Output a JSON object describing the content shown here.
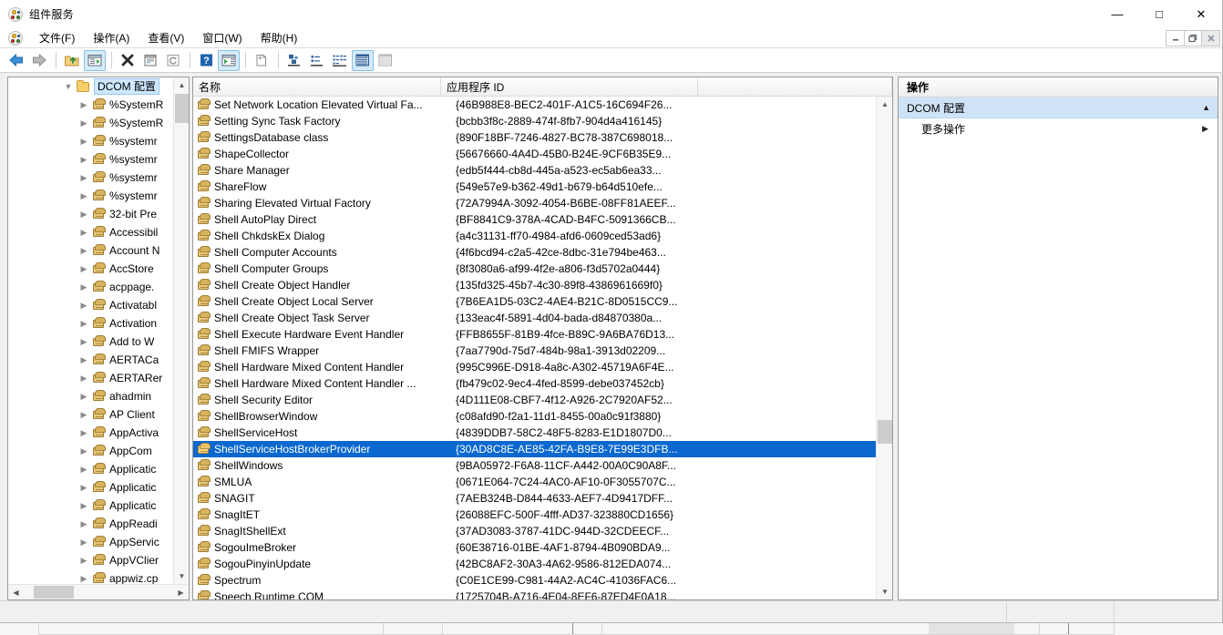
{
  "window": {
    "title": "组件服务",
    "icon": "component-services-icon",
    "minimize": "—",
    "maximize": "□",
    "close": "✕"
  },
  "menubar": {
    "icon": "component-services-icon",
    "items": [
      {
        "label": "文件(F)",
        "name": "menu-file"
      },
      {
        "label": "操作(A)",
        "name": "menu-action"
      },
      {
        "label": "查看(V)",
        "name": "menu-view"
      },
      {
        "label": "窗口(W)",
        "name": "menu-window"
      },
      {
        "label": "帮助(H)",
        "name": "menu-help"
      }
    ],
    "mdi_buttons": [
      {
        "label": "–",
        "name": "mdi-minimize-button"
      },
      {
        "label": "❐",
        "name": "mdi-restore-button"
      },
      {
        "label": "✕",
        "name": "mdi-close-button"
      }
    ]
  },
  "toolbar": {
    "buttons": [
      {
        "name": "back-button",
        "icon": "arrow-left-icon",
        "checked": false
      },
      {
        "name": "forward-button",
        "icon": "arrow-right-icon",
        "checked": false
      },
      {
        "name": "up-one-level-button",
        "icon": "folder-up-icon",
        "checked": false
      },
      {
        "name": "show-hide-console-tree-button",
        "icon": "console-tree-icon",
        "checked": true
      },
      {
        "name": "delete-button",
        "icon": "delete-x-icon",
        "checked": false
      },
      {
        "name": "properties-button",
        "icon": "properties-icon",
        "checked": false
      },
      {
        "name": "refresh-button",
        "icon": "refresh-icon",
        "checked": false
      },
      {
        "name": "help-button",
        "icon": "question-mark-icon",
        "checked": false
      },
      {
        "name": "show-hide-action-pane-button",
        "icon": "action-pane-icon",
        "checked": true
      },
      {
        "name": "export-list-button",
        "icon": "export-list-icon",
        "checked": false
      },
      {
        "name": "view-large-icons-button",
        "icon": "large-icons-icon",
        "checked": false
      },
      {
        "name": "view-small-icons-button",
        "icon": "small-icons-icon",
        "checked": false
      },
      {
        "name": "view-list-button",
        "icon": "list-view-icon",
        "checked": false
      },
      {
        "name": "view-detail-button",
        "icon": "detail-view-icon",
        "checked": true
      },
      {
        "name": "view-tabular-button",
        "icon": "tabular-view-icon",
        "checked": false
      }
    ]
  },
  "tree": {
    "root": {
      "label": "DCOM 配置",
      "icon": "folder-icon",
      "expanded": true
    },
    "items": [
      {
        "label": "%SystemR",
        "icon": "dcom-component-icon"
      },
      {
        "label": "%SystemR",
        "icon": "dcom-component-icon"
      },
      {
        "label": "%systemr",
        "icon": "dcom-component-icon"
      },
      {
        "label": "%systemr",
        "icon": "dcom-component-icon"
      },
      {
        "label": "%systemr",
        "icon": "dcom-component-icon"
      },
      {
        "label": "%systemr",
        "icon": "dcom-component-icon"
      },
      {
        "label": "32-bit Pre",
        "icon": "dcom-component-icon"
      },
      {
        "label": "Accessibil",
        "icon": "dcom-component-icon"
      },
      {
        "label": "Account N",
        "icon": "dcom-component-icon"
      },
      {
        "label": "AccStore",
        "icon": "dcom-component-icon"
      },
      {
        "label": "acppage.",
        "icon": "dcom-component-icon"
      },
      {
        "label": "Activatabl",
        "icon": "dcom-component-icon"
      },
      {
        "label": "Activation",
        "icon": "dcom-component-icon"
      },
      {
        "label": "Add to W",
        "icon": "dcom-component-icon"
      },
      {
        "label": "AERTACa",
        "icon": "dcom-component-icon"
      },
      {
        "label": "AERTARer",
        "icon": "dcom-component-icon"
      },
      {
        "label": "ahadmin",
        "icon": "dcom-component-icon"
      },
      {
        "label": "AP Client",
        "icon": "dcom-component-icon"
      },
      {
        "label": "AppActiva",
        "icon": "dcom-component-icon"
      },
      {
        "label": "AppCom",
        "icon": "dcom-component-icon"
      },
      {
        "label": "Applicatic",
        "icon": "dcom-component-icon"
      },
      {
        "label": "Applicatic",
        "icon": "dcom-component-icon"
      },
      {
        "label": "Applicatic",
        "icon": "dcom-component-icon"
      },
      {
        "label": "AppReadi",
        "icon": "dcom-component-icon"
      },
      {
        "label": "AppServic",
        "icon": "dcom-component-icon"
      },
      {
        "label": "AppVClier",
        "icon": "dcom-component-icon"
      },
      {
        "label": "appwiz.cp",
        "icon": "dcom-component-icon"
      }
    ]
  },
  "list": {
    "columns": [
      "名称",
      "应用程序 ID",
      ""
    ],
    "selected_index": 21,
    "rows": [
      {
        "name": "Set Network Location Elevated Virtual Fa...",
        "appid": "{46B988E8-BEC2-401F-A1C5-16C694F26..."
      },
      {
        "name": "Setting Sync Task Factory",
        "appid": "{bcbb3f8c-2889-474f-8fb7-904d4a416145}"
      },
      {
        "name": "SettingsDatabase class",
        "appid": "{890F18BF-7246-4827-BC78-387C698018..."
      },
      {
        "name": "ShapeCollector",
        "appid": "{56676660-4A4D-45B0-B24E-9CF6B35E9..."
      },
      {
        "name": "Share Manager",
        "appid": "{edb5f444-cb8d-445a-a523-ec5ab6ea33..."
      },
      {
        "name": "ShareFlow",
        "appid": "{549e57e9-b362-49d1-b679-b64d510efe..."
      },
      {
        "name": "Sharing Elevated Virtual Factory",
        "appid": "{72A7994A-3092-4054-B6BE-08FF81AEEF..."
      },
      {
        "name": "Shell AutoPlay Direct",
        "appid": "{BF8841C9-378A-4CAD-B4FC-5091366CB..."
      },
      {
        "name": "Shell ChkdskEx Dialog",
        "appid": "{a4c31131-ff70-4984-afd6-0609ced53ad6}"
      },
      {
        "name": "Shell Computer Accounts",
        "appid": "{4f6bcd94-c2a5-42ce-8dbc-31e794be463..."
      },
      {
        "name": "Shell Computer Groups",
        "appid": "{8f3080a6-af99-4f2e-a806-f3d5702a0444}"
      },
      {
        "name": "Shell Create Object Handler",
        "appid": "{135fd325-45b7-4c30-89f8-4386961669f0}"
      },
      {
        "name": "Shell Create Object Local Server",
        "appid": "{7B6EA1D5-03C2-4AE4-B21C-8D0515CC9..."
      },
      {
        "name": "Shell Create Object Task Server",
        "appid": "{133eac4f-5891-4d04-bada-d84870380a..."
      },
      {
        "name": "Shell Execute Hardware Event Handler",
        "appid": "{FFB8655F-81B9-4fce-B89C-9A6BA76D13..."
      },
      {
        "name": "Shell FMIFS Wrapper",
        "appid": "{7aa7790d-75d7-484b-98a1-3913d02209..."
      },
      {
        "name": "Shell Hardware Mixed Content Handler",
        "appid": "{995C996E-D918-4a8c-A302-45719A6F4E..."
      },
      {
        "name": "Shell Hardware Mixed Content Handler ...",
        "appid": "{fb479c02-9ec4-4fed-8599-debe037452cb}"
      },
      {
        "name": "Shell Security Editor",
        "appid": "{4D111E08-CBF7-4f12-A926-2C7920AF52..."
      },
      {
        "name": "ShellBrowserWindow",
        "appid": "{c08afd90-f2a1-11d1-8455-00a0c91f3880}"
      },
      {
        "name": "ShellServiceHost",
        "appid": "{4839DDB7-58C2-48F5-8283-E1D1807D0..."
      },
      {
        "name": "ShellServiceHostBrokerProvider",
        "appid": "{30AD8C8E-AE85-42FA-B9E8-7E99E3DFB..."
      },
      {
        "name": "ShellWindows",
        "appid": "{9BA05972-F6A8-11CF-A442-00A0C90A8F..."
      },
      {
        "name": "SMLUA",
        "appid": "{0671E064-7C24-4AC0-AF10-0F3055707C..."
      },
      {
        "name": "SNAGIT",
        "appid": "{7AEB324B-D844-4633-AEF7-4D9417DFF..."
      },
      {
        "name": "SnagItET",
        "appid": "{26088EFC-500F-4fff-AD37-323880CD1656}"
      },
      {
        "name": "SnagItShellExt",
        "appid": "{37AD3083-3787-41DC-944D-32CDEECF..."
      },
      {
        "name": "SogouImeBroker",
        "appid": "{60E38716-01BE-4AF1-8794-4B090BDA9..."
      },
      {
        "name": "SogouPinyinUpdate",
        "appid": "{42BC8AF2-30A3-4A62-9586-812EDA074..."
      },
      {
        "name": "Spectrum",
        "appid": "{C0E1CE99-C981-44A2-AC4C-41036FAC6..."
      },
      {
        "name": "Speech Runtime COM",
        "appid": "{1725704B-A716-4E04-8EF6-87ED4F0A18..."
      }
    ]
  },
  "actions": {
    "title": "操作",
    "group": {
      "label": "DCOM 配置",
      "chevron": "▲"
    },
    "items": [
      {
        "label": "更多操作",
        "arrow": "▶"
      }
    ]
  },
  "statusbar": {
    "main": "",
    "pane2": "",
    "pane3": ""
  },
  "colors": {
    "selection": "#0a68ce",
    "action_group": "#cfe3f7",
    "toolbar_checked": "#d6ebf9",
    "tree_root_select": "#cde8ff"
  }
}
